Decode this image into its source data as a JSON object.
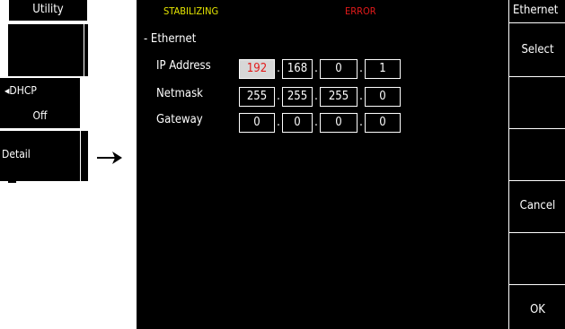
{
  "left_menu": {
    "title": "Utility",
    "dhcp_label": "◂DHCP",
    "dhcp_value": "Off",
    "detail_label": "Detail"
  },
  "status": {
    "stabilizing": "STABILIZING",
    "error": "ERROR",
    "stabilizing_color": "#e6e600",
    "error_color": "#e21a1a"
  },
  "section": {
    "title": "- Ethernet"
  },
  "rows": [
    {
      "label": "IP Address",
      "octets": [
        "192",
        "168",
        "0",
        "1"
      ],
      "selected_octet": 0
    },
    {
      "label": "Netmask",
      "octets": [
        "255",
        "255",
        "255",
        "0"
      ]
    },
    {
      "label": "Gateway",
      "octets": [
        "0",
        "0",
        "0",
        "0"
      ]
    }
  ],
  "softkeys": {
    "header": "Ethernet",
    "select": "Select",
    "cancel": "Cancel",
    "ok": "OK"
  },
  "colors": {
    "background": "#000000",
    "foreground": "#ffffff",
    "selected_field_bg": "#d7d7d7",
    "selected_field_text": "#e21a1a"
  }
}
